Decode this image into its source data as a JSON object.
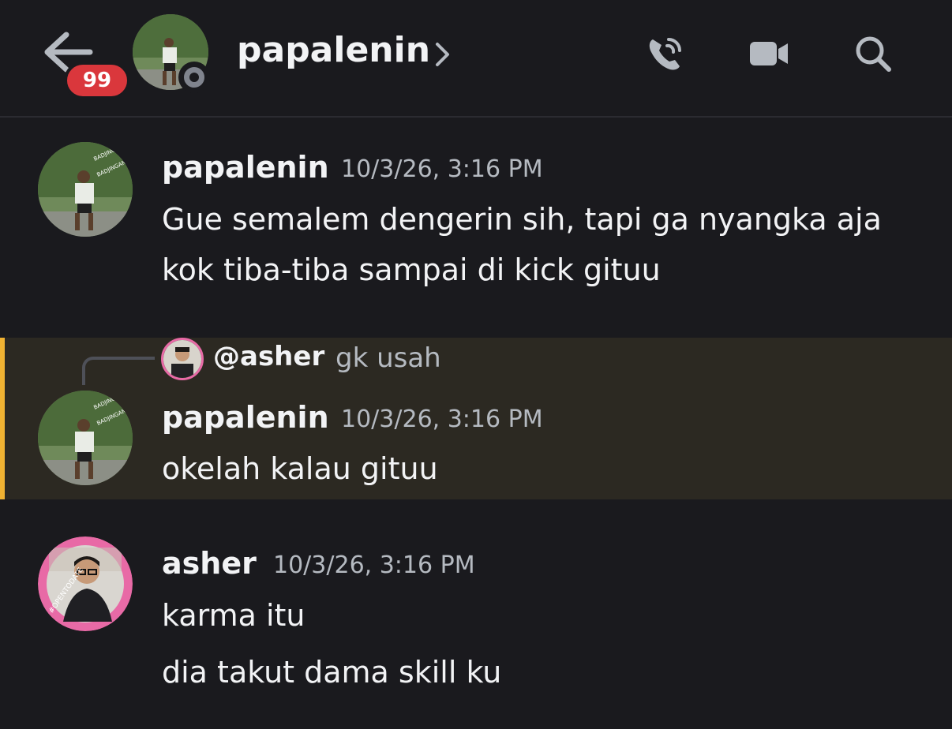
{
  "header": {
    "unread_badge": "99",
    "title": "papalenin"
  },
  "messages": [
    {
      "author": "papalenin",
      "timestamp": "10/3/26, 3:16 PM",
      "lines": [
        "Gue semalem dengerin sih, tapi ga nyangka aja",
        "kok tiba-tiba sampai di kick gituu"
      ]
    },
    {
      "reply": {
        "author": "@asher",
        "text": "gk usah"
      },
      "author": "papalenin",
      "timestamp": "10/3/26, 3:16 PM",
      "lines": [
        "okelah kalau gituu"
      ]
    },
    {
      "author": "asher",
      "timestamp": "10/3/26, 3:16 PM",
      "lines": [
        "karma itu",
        "dia takut dama skill ku"
      ]
    }
  ],
  "avatar_text": {
    "papalenin_watermark": "BADJINGAN",
    "asher_ring": "#OPENTODATE"
  },
  "colors": {
    "background": "#1a1a1e",
    "mention_highlight": "#2c2922",
    "mention_bar": "#f0b232",
    "badge": "#da373c",
    "status_offline": "#80848e",
    "asher_ring": "#e86aa6"
  },
  "icons": [
    "back-arrow-icon",
    "chevron-right-icon",
    "phone-call-icon",
    "video-camera-icon",
    "search-icon"
  ]
}
